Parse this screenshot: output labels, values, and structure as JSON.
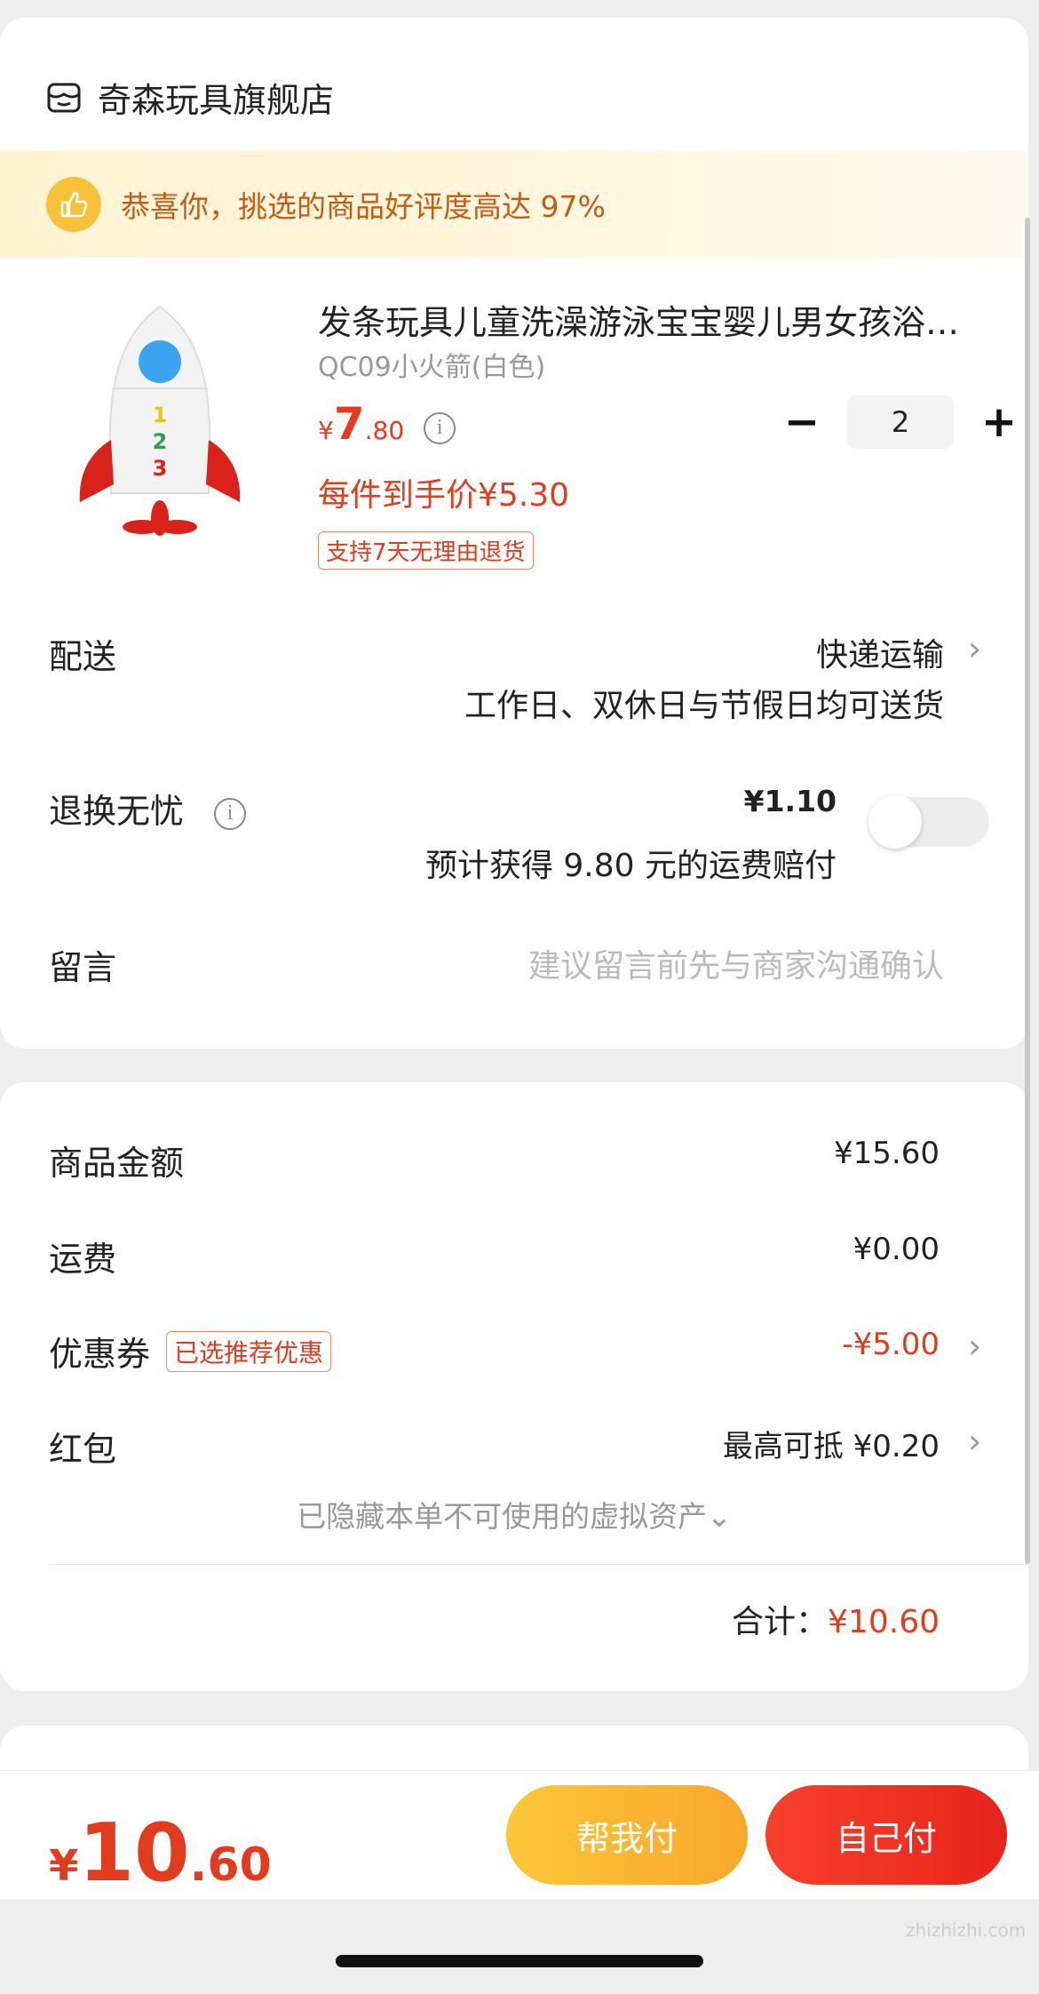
{
  "shop": {
    "name": "奇森玩具旗舰店",
    "icon": "shop-icon"
  },
  "banner": {
    "text": "恭喜你，挑选的商品好评度高达 97%",
    "icon": "thumbs-up-icon"
  },
  "product": {
    "title": "发条玩具儿童洗澡游泳宝宝婴儿男女孩浴室戏水玩具",
    "spec": "QC09小火箭(白色)",
    "price_symbol": "¥",
    "price_int": "7",
    "price_dec": ".80",
    "per_price": "每件到手价¥5.30",
    "return_tag": "支持7天无理由退货",
    "quantity": "2",
    "minus": "−",
    "plus": "+"
  },
  "delivery": {
    "label": "配送",
    "method": "快递运输",
    "note": "工作日、双休日与节假日均可送货"
  },
  "return_insurance": {
    "label": "退换无忧",
    "price": "¥1.10",
    "note": "预计获得 9.80 元的运费赔付",
    "enabled": false
  },
  "message": {
    "label": "留言",
    "placeholder": "建议留言前先与商家沟通确认"
  },
  "summary": {
    "goods_label": "商品金额",
    "goods_value": "¥15.60",
    "shipping_label": "运费",
    "shipping_value": "¥0.00",
    "coupon_label": "优惠券",
    "coupon_tag": "已选推荐优惠",
    "coupon_value": "-¥5.00",
    "redpacket_label": "红包",
    "redpacket_value": "最高可抵 ¥0.20",
    "hidden_note": "已隐藏本单不可使用的虚拟资产⌄",
    "total_label": "合计：",
    "total_value": "¥10.60"
  },
  "bottom": {
    "symbol": "¥",
    "int": "10",
    "dec": ".60",
    "help_pay": "帮我付",
    "self_pay": "自己付"
  },
  "watermark": "zhizhizhi.com",
  "colors": {
    "accent_red": "#e23c1e",
    "banner_orange": "#c55b14",
    "help_yellow": "#fcc63a"
  }
}
